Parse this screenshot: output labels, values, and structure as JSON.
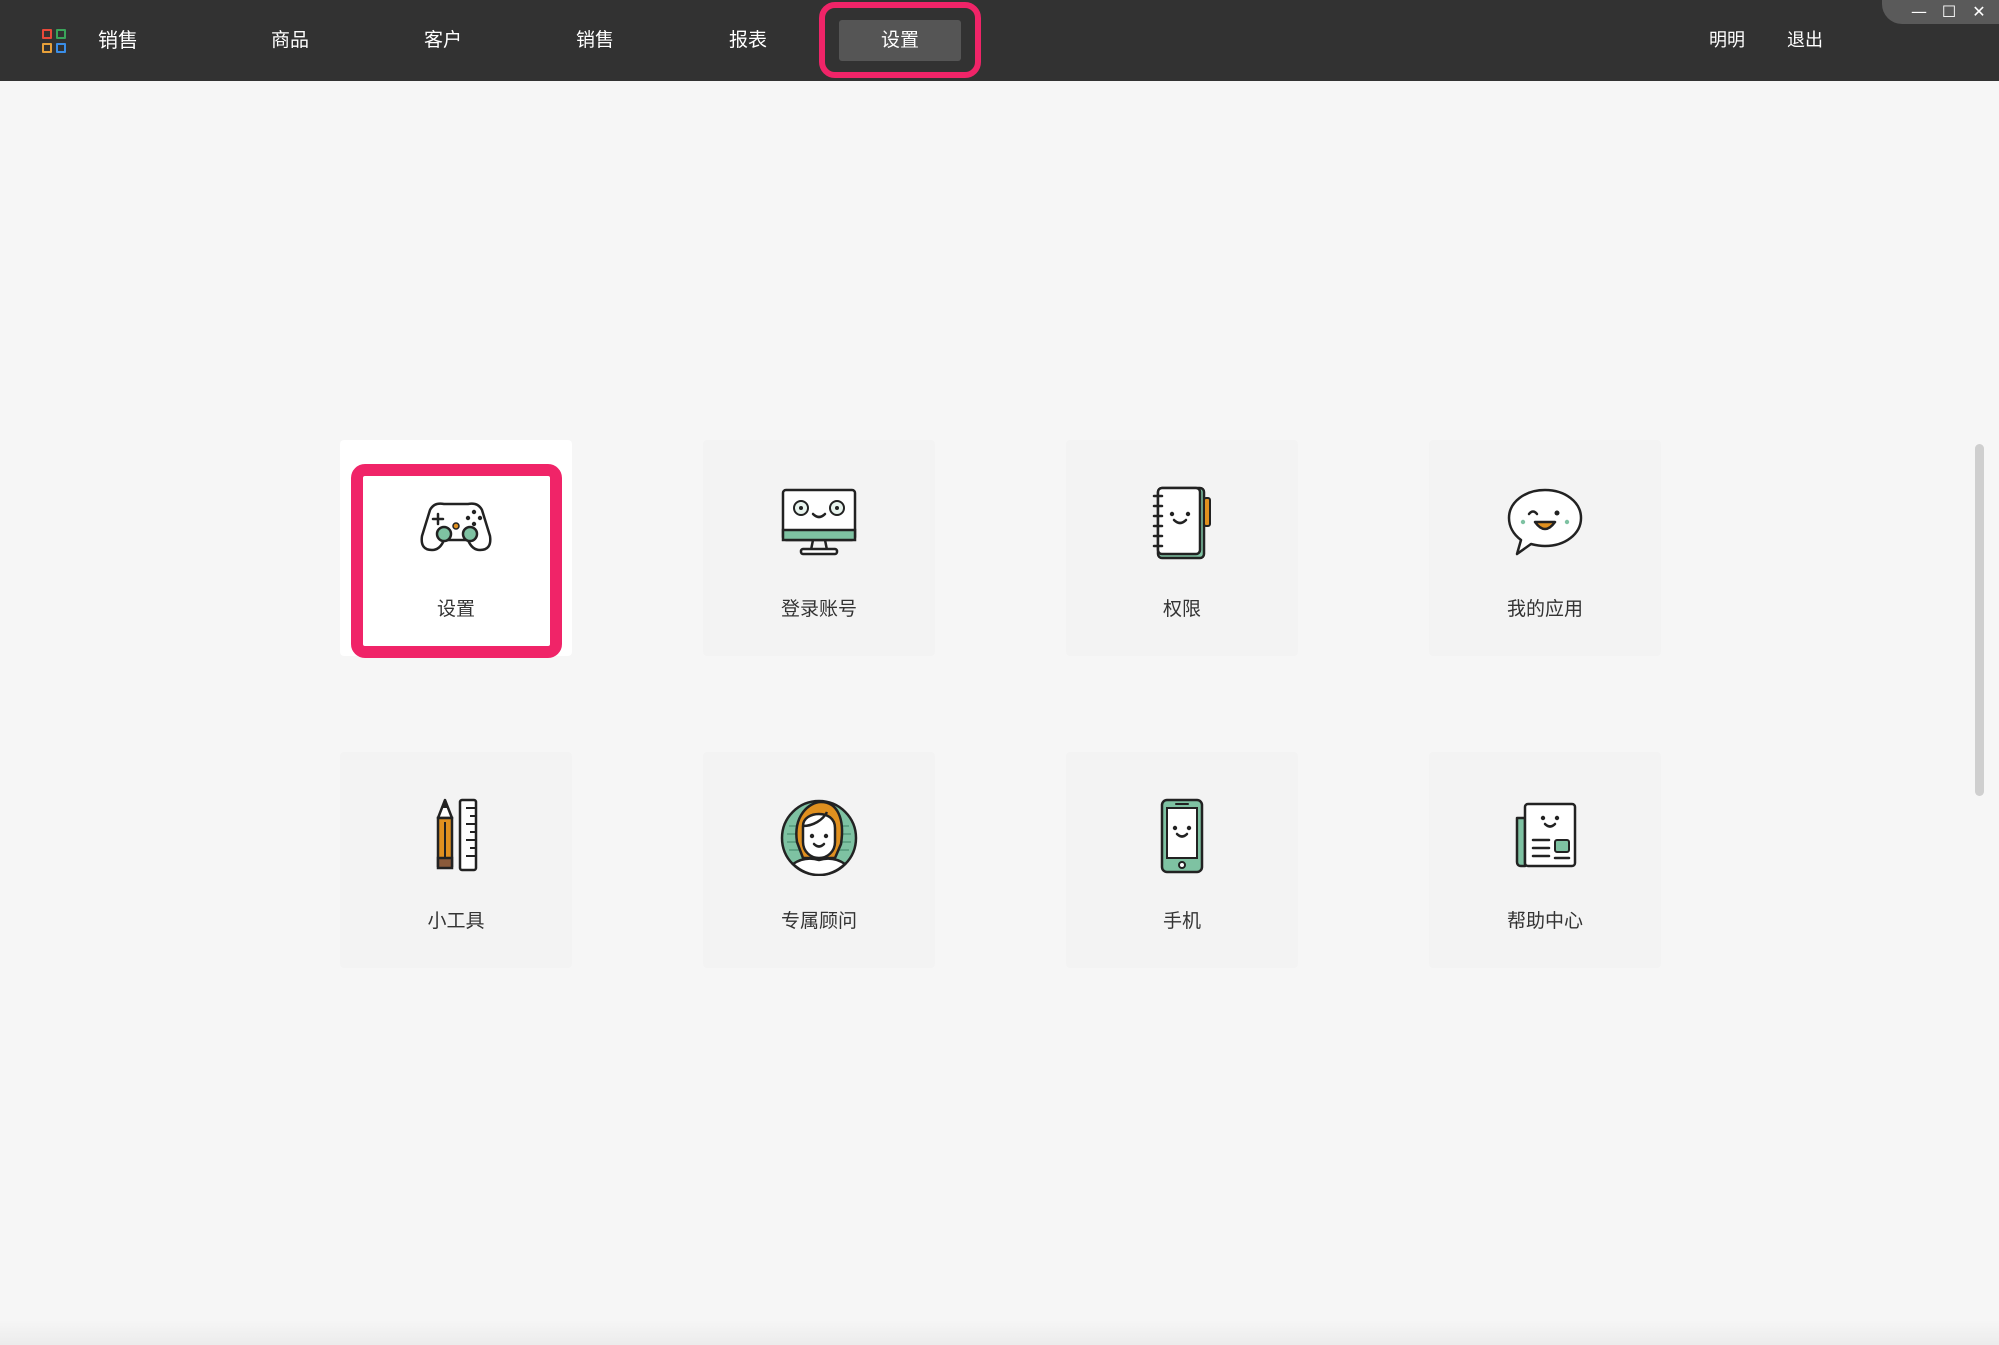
{
  "app": {
    "title": "销售"
  },
  "nav": [
    {
      "label": "商品"
    },
    {
      "label": "客户"
    },
    {
      "label": "销售"
    },
    {
      "label": "报表"
    },
    {
      "label": "设置",
      "active": true
    }
  ],
  "user": {
    "name": "明明",
    "logout": "退出"
  },
  "window_controls": {
    "minimize": "—",
    "maximize": "☐",
    "close": "✕"
  },
  "accent_colors": {
    "highlight": "#f02468",
    "icon_green": "#7ec2a2",
    "icon_orange": "#e0901f",
    "topbar": "#323232"
  },
  "tiles": [
    {
      "label": "设置",
      "icon": "gamepad-icon",
      "selected": true
    },
    {
      "label": "登录账号",
      "icon": "monitor-icon"
    },
    {
      "label": "权限",
      "icon": "notebook-icon"
    },
    {
      "label": "我的应用",
      "icon": "chat-bubble-icon"
    },
    {
      "label": "小工具",
      "icon": "pencil-ruler-icon"
    },
    {
      "label": "专属顾问",
      "icon": "advisor-avatar-icon"
    },
    {
      "label": "手机",
      "icon": "phone-icon"
    },
    {
      "label": "帮助中心",
      "icon": "newspaper-icon"
    }
  ]
}
